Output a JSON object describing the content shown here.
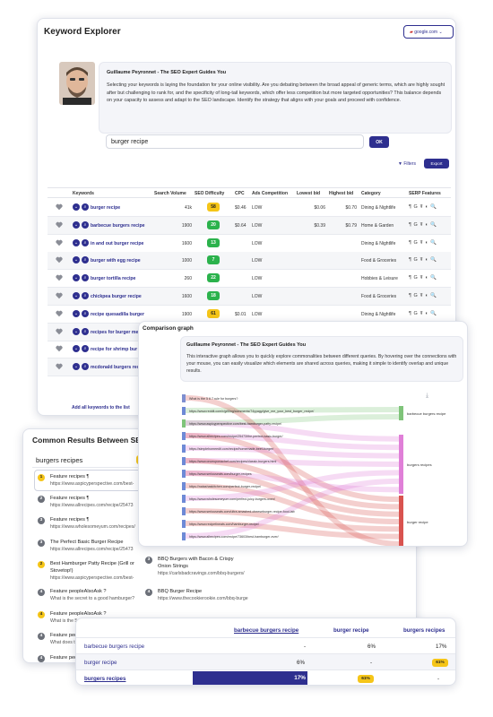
{
  "keyword_explorer": {
    "title": "Keyword Explorer",
    "engine": "google.com",
    "quote_name": "Guillaume Peyronnet - The SEO Expert Guides You",
    "quote_text": "Selecting your keywords is laying the foundation for your online visibility. Are you debating between the broad appeal of generic terms, which are highly sought after but challenging to rank for, and the specificity of long-tail keywords, which offer less competition but more targeted opportunities? This balance depends on your capacity to assess and adapt to the SEO landscape. Identify the strategy that aligns with your goals and proceed with confidence.",
    "search_value": "burger recipe",
    "ok_label": "OK",
    "filters_label": "Filters",
    "export_label": "Export",
    "headers": [
      "Keywords",
      "Search Volume",
      "SEO Difficulty",
      "CPC",
      "Ads Competition",
      "Lowest bid",
      "Highest bid",
      "Category",
      "SERP Features"
    ],
    "rows": [
      {
        "kw": "burger recipe",
        "vol": "41k",
        "diff": "58",
        "dc": "#f5c518",
        "cpc": "$0.46",
        "ads": "LOW",
        "low": "$0.06",
        "high": "$0.70",
        "cat": "Dining & Nightlife"
      },
      {
        "kw": "barbecue burgers recipe",
        "vol": "1900",
        "diff": "20",
        "dc": "#2bb24c",
        "cpc": "$0.64",
        "ads": "LOW",
        "low": "$0.39",
        "high": "$0.79",
        "cat": "Home & Garden"
      },
      {
        "kw": "in and out burger recipe",
        "vol": "1600",
        "diff": "13",
        "dc": "#2bb24c",
        "cpc": "",
        "ads": "LOW",
        "low": "",
        "high": "",
        "cat": "Dining & Nightlife"
      },
      {
        "kw": "burger with egg recipe",
        "vol": "1000",
        "diff": "7",
        "dc": "#2bb24c",
        "cpc": "",
        "ads": "LOW",
        "low": "",
        "high": "",
        "cat": "Food & Groceries"
      },
      {
        "kw": "burger tortilla recipe",
        "vol": "260",
        "diff": "22",
        "dc": "#2bb24c",
        "cpc": "",
        "ads": "LOW",
        "low": "",
        "high": "",
        "cat": "Hobbies & Leisure"
      },
      {
        "kw": "chickpea burger recipe",
        "vol": "1600",
        "diff": "18",
        "dc": "#2bb24c",
        "cpc": "",
        "ads": "LOW",
        "low": "",
        "high": "",
        "cat": "Food & Groceries"
      },
      {
        "kw": "recipe quesadilla burger",
        "vol": "1900",
        "diff": "61",
        "dc": "#f5c518",
        "cpc": "$0.01",
        "ads": "LOW",
        "low": "",
        "high": "",
        "cat": "Dining & Nightlife"
      },
      {
        "kw": "recipes for burger me",
        "vol": "",
        "diff": "",
        "dc": "",
        "cpc": "",
        "ads": "",
        "low": "",
        "high": "",
        "cat": ""
      },
      {
        "kw": "recipe for shrimp bur",
        "vol": "",
        "diff": "",
        "dc": "",
        "cpc": "",
        "ads": "",
        "low": "",
        "high": "",
        "cat": ""
      },
      {
        "kw": "mcdonald burgers rec",
        "vol": "",
        "diff": "",
        "dc": "",
        "cpc": "",
        "ads": "",
        "low": "",
        "high": "",
        "cat": ""
      }
    ],
    "serp_glyphs": "¶ G ☤ ◐ 🔍",
    "add_all_label": "Add all keywords to the list"
  },
  "comparison_graph": {
    "title": "Comparison graph",
    "quote_name": "Guillaume Peyronnet - The SEO Expert Guides You",
    "quote_text": "This interactive graph allows you to quickly explore commonalities between different queries. By hovering over the connections with your mouse, you can easily visualize which elements are shared across queries, making it simple to identify overlap and unique results.",
    "left_nodes": [
      "What is the 5 6 7 rule for burgers?",
      "https://www.reddit.com/r/grilling/comments/74yyagy/give_me_your_best_burger_recipe/",
      "https://www.aspicyperspective.com/best-hamburger-patty-recipe/",
      "https://www.allrecipes.com/recipe/25473/the-perfect-basic-burger/",
      "https://simplehomeedit.com/recipe/homemade-beef-burger/",
      "https://www.onceuponachef.com/recipes/classic-burgers.html",
      "https://www.seriouseats.com/burger-recipes",
      "https://natashaskitchen.com/perfect-burger-recipe/",
      "https://www.wholesomeyum.com/perfect-juicy-burgers-oven/",
      "https://www.seriouseats.com/ultra-smashed-cheeseburger-recipe-food-lab",
      "https://www.recipetineats.com/hamburger-recipe/",
      "https://www.allrecipes.com/recipe/73603/best-hamburger-ever/"
    ],
    "right_nodes": [
      "barbecue burgers recipe",
      "burgers recipes",
      "burger recipe"
    ],
    "right_colors": [
      "#7fc47a",
      "#e07fd8",
      "#d9534f"
    ]
  },
  "common_results": {
    "title": "Common Results Between SE",
    "query": "burgers recipes",
    "count": "54",
    "results_left": [
      {
        "n": "1",
        "c": "y",
        "title": "Feature recipes ¶",
        "url": "https://www.aspicyperspective.com/best-",
        "hl": true
      },
      {
        "n": "2",
        "c": "g",
        "title": "Feature recipes ¶",
        "url": "https://www.allrecipes.com/recipe/25473"
      },
      {
        "n": "3",
        "c": "g",
        "title": "Feature recipes ¶",
        "url": "https://www.wholesomeyum.com/recipes/"
      },
      {
        "n": "3",
        "c": "g",
        "title": "The Perfect Basic Burger Recipe",
        "url": "https://www.allrecipes.com/recipe/25473"
      },
      {
        "n": "2",
        "c": "y",
        "title": "Best Hamburger Patty Recipe (Grill or",
        "title2": "Stovetop!)",
        "url": "https://www.aspicyperspective.com/best-"
      },
      {
        "n": "4",
        "c": "g",
        "title": "Feature peopleAlsoAsk ?",
        "url": "What is the secret to a good hamburger?"
      },
      {
        "n": "4",
        "c": "y",
        "title": "Feature peopleAlsoAsk ?",
        "url": "What is the 5 6 7 rule for burgers?"
      },
      {
        "n": "4",
        "c": "g",
        "title": "Feature peopleAlsoAsk ?",
        "url": "What does t"
      },
      {
        "n": "4",
        "c": "g",
        "title": "Feature peopleAlsoAsk ?",
        "url": "What to put"
      }
    ],
    "results_right": [
      {
        "n": "3",
        "c": "g",
        "title": "BBQ Burgers with Bacon & Crispy",
        "title2": "Onion Strings",
        "url": "https://carlsbadcravings.com/bbq-burgers/"
      },
      {
        "n": "4",
        "c": "g",
        "title": "BBQ Burger Recipe",
        "url": "https://www.thecookierookie.com/bbq-burge"
      }
    ]
  },
  "matrix": {
    "headers": [
      "barbecue burgers recipe",
      "burger recipe",
      "burgers recipes"
    ],
    "rows": [
      {
        "label": "barbecue burgers recipe",
        "v": [
          "-",
          "6%",
          "17%"
        ]
      },
      {
        "label": "burger recipe",
        "v": [
          "6%",
          "-",
          "61%"
        ]
      },
      {
        "label": "burgers recipes",
        "v": [
          "17%",
          "61%",
          "-"
        ]
      }
    ]
  }
}
